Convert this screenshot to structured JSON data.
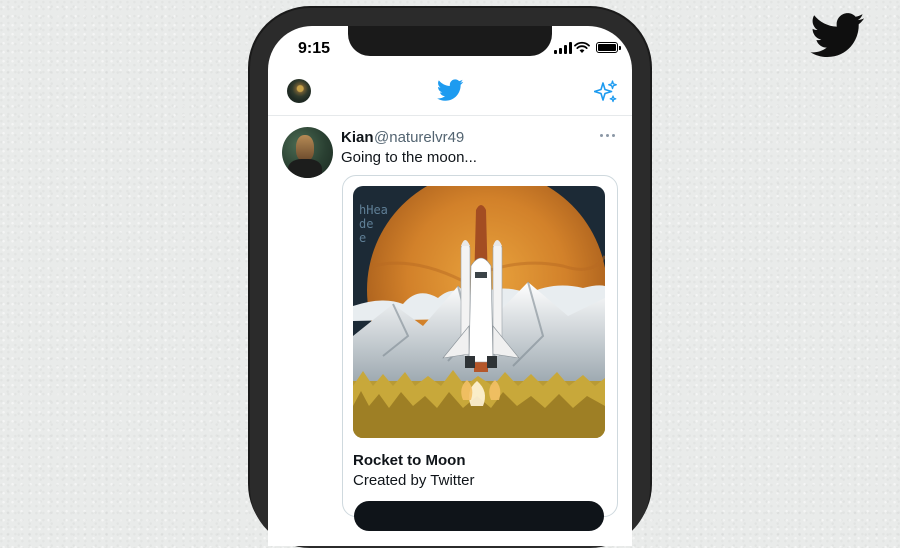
{
  "status_bar": {
    "time": "9:15"
  },
  "nav": {
    "avatar_icon": "profile-avatar",
    "logo_icon": "twitter-bird-icon",
    "sparkle_icon": "sparkle-icon"
  },
  "tweet": {
    "name": "Kian",
    "handle": "@naturelvr49",
    "text": "Going to the moon...",
    "card": {
      "title": "Rocket to Moon",
      "subtitle": "Created by Twitter",
      "image_texts": [
        "hHea",
        "de",
        "e"
      ]
    }
  },
  "colors": {
    "brand_blue": "#1d9bf0",
    "background": "#e9ebea",
    "text_primary": "#0f1419",
    "text_secondary": "#536471"
  }
}
